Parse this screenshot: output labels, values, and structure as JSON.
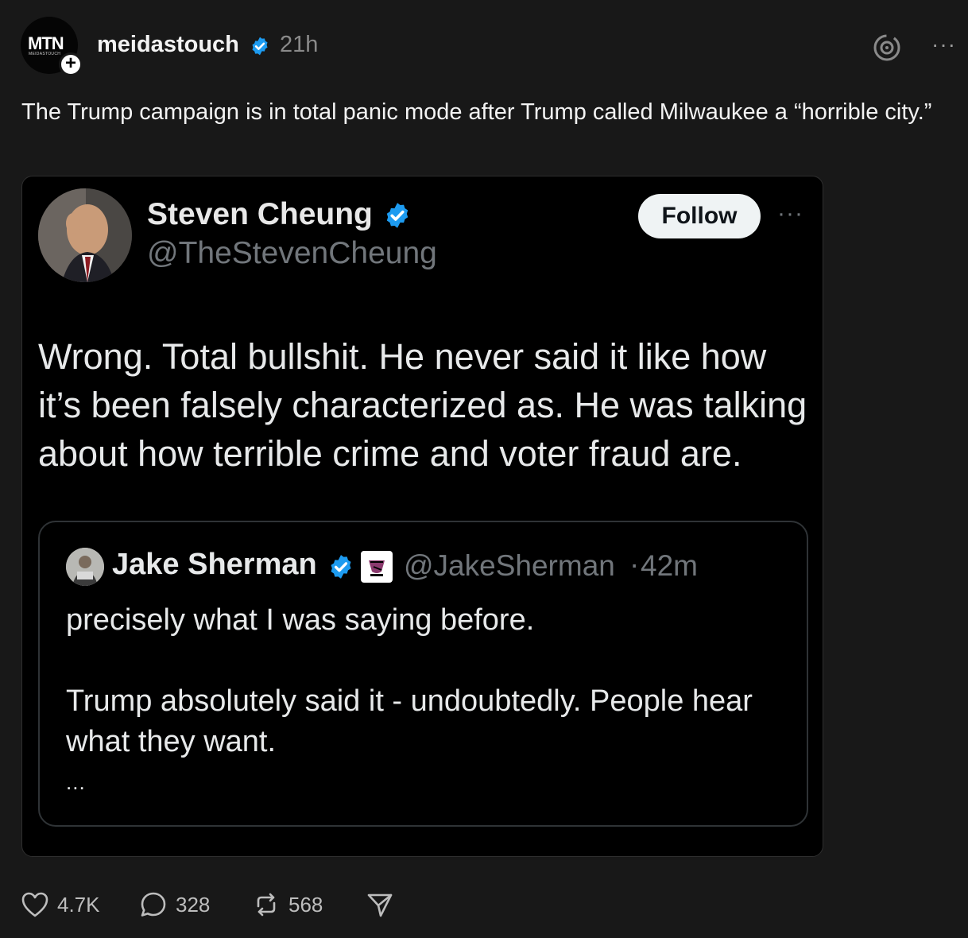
{
  "post": {
    "avatar_logo": "MTN",
    "avatar_sub": "MEIDASTOUCH",
    "username": "meidastouch",
    "time_ago": "21h",
    "text": "The Trump campaign is in total panic mode after Trump called Milwaukee a “horrible city.”"
  },
  "screenshot": {
    "author_name": "Steven Cheung",
    "author_handle": "@TheStevenCheung",
    "follow_label": "Follow",
    "more_label": "···",
    "text": "Wrong. Total bullshit. He never said it like how it’s been falsely characterized as. He was talking about how terrible crime and voter fraud are.",
    "quote": {
      "author_name": "Jake Sherman",
      "author_handle": "@JakeSherman",
      "separator": "·",
      "time": "42m",
      "line1": "precisely what I was saying before.",
      "line2": "Trump absolutely said it - undoubtedly. People hear what they want.",
      "ellipsis": "..."
    }
  },
  "actions": {
    "likes": "4.7K",
    "replies": "328",
    "reposts": "568"
  },
  "more_label": "···",
  "colors": {
    "background": "#181818",
    "verified_blue": "#1d9bf0",
    "muted_gray": "#71767b"
  }
}
